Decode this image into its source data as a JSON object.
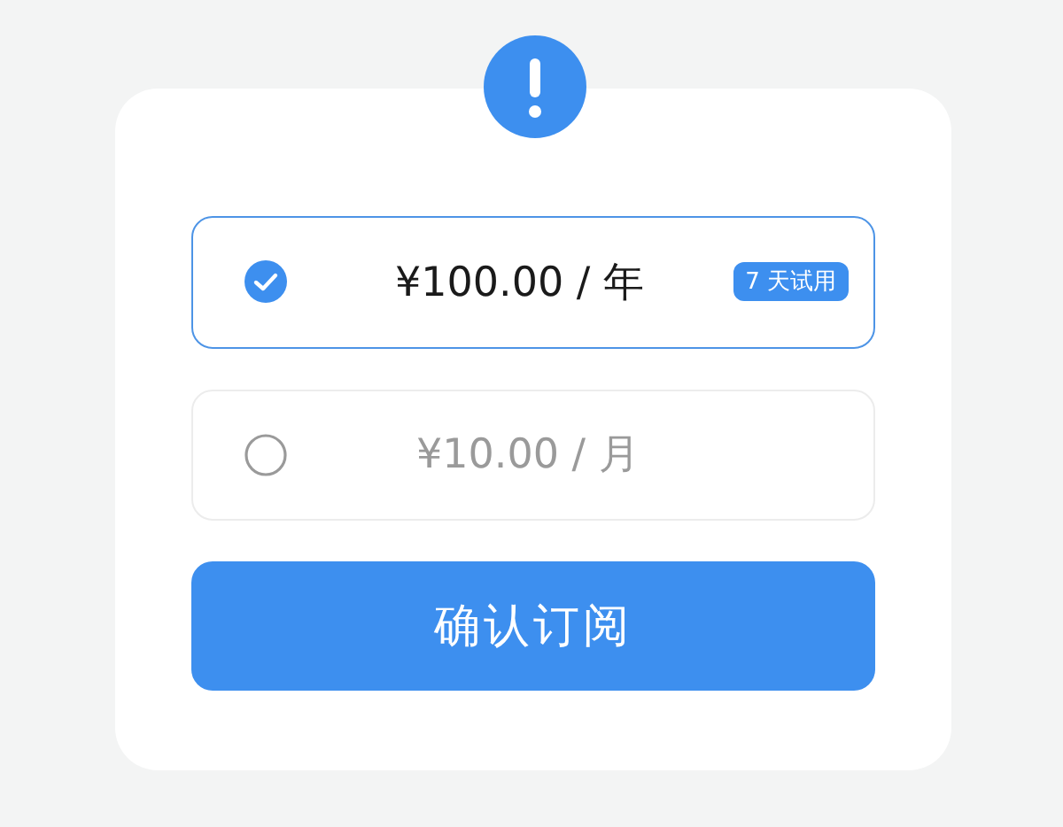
{
  "options": [
    {
      "price": "¥100.00 / 年",
      "badge": "7 天试用",
      "selected": true
    },
    {
      "price": "¥10.00 / 月",
      "selected": false
    }
  ],
  "confirm_button": "确认订阅"
}
